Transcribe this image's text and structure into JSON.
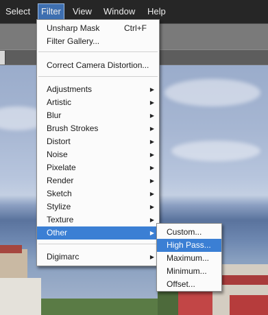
{
  "menubar": {
    "items": [
      {
        "label": "Select"
      },
      {
        "label": "Filter",
        "active": true
      },
      {
        "label": "View"
      },
      {
        "label": "Window"
      },
      {
        "label": "Help"
      }
    ]
  },
  "filter_menu": {
    "items": [
      {
        "label": "Unsharp Mask",
        "shortcut": "Ctrl+F"
      },
      {
        "label": "Filter Gallery..."
      },
      {
        "label": "Correct Camera Distortion..."
      },
      {
        "label": "Adjustments",
        "submenu": true
      },
      {
        "label": "Artistic",
        "submenu": true
      },
      {
        "label": "Blur",
        "submenu": true
      },
      {
        "label": "Brush Strokes",
        "submenu": true
      },
      {
        "label": "Distort",
        "submenu": true
      },
      {
        "label": "Noise",
        "submenu": true
      },
      {
        "label": "Pixelate",
        "submenu": true
      },
      {
        "label": "Render",
        "submenu": true
      },
      {
        "label": "Sketch",
        "submenu": true
      },
      {
        "label": "Stylize",
        "submenu": true
      },
      {
        "label": "Texture",
        "submenu": true
      },
      {
        "label": "Other",
        "submenu": true,
        "highlighted": true
      },
      {
        "label": "Digimarc",
        "submenu": true
      }
    ]
  },
  "other_submenu": {
    "items": [
      {
        "label": "Custom..."
      },
      {
        "label": "High Pass...",
        "highlighted": true
      },
      {
        "label": "Maximum..."
      },
      {
        "label": "Minimum..."
      },
      {
        "label": "Offset..."
      }
    ]
  },
  "icons": {
    "submenu_arrow": "▶"
  },
  "colors": {
    "menu_highlight": "#3b7fd4",
    "menubar_bg": "#262626",
    "menubar_active": "#3e6fb0"
  }
}
